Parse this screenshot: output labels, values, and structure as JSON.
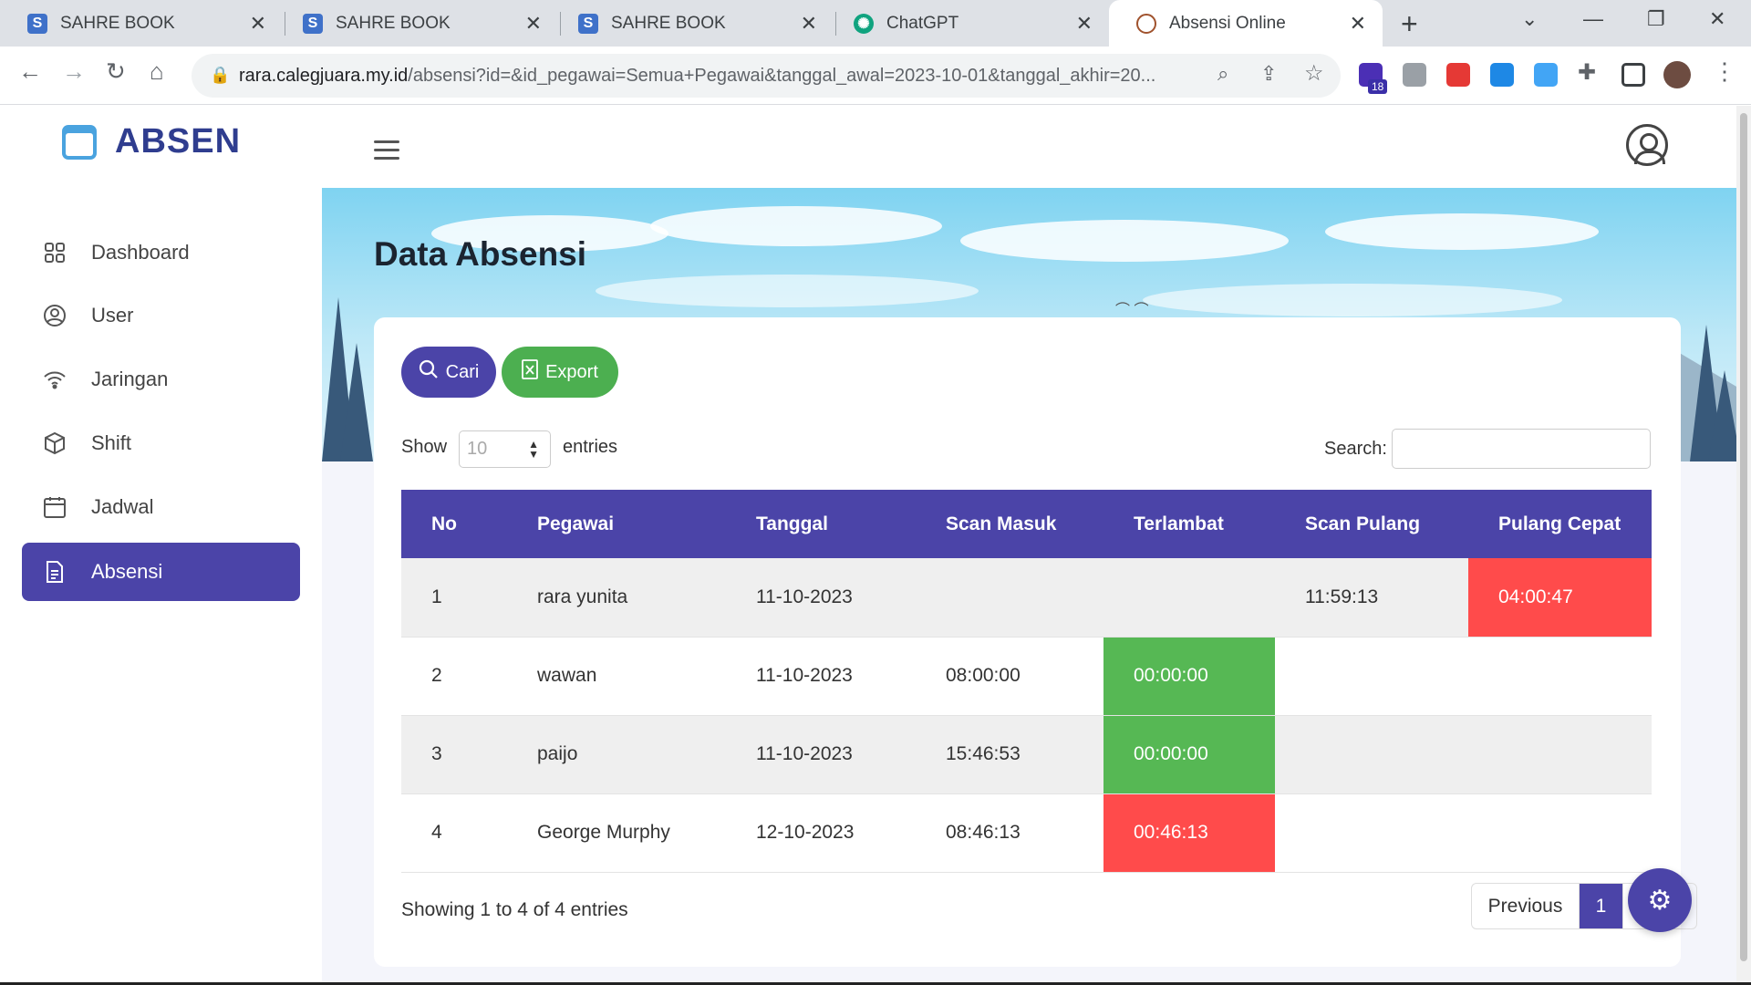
{
  "browser": {
    "tabs": [
      {
        "title": "SAHRE BOOK",
        "icon": "s-favicon",
        "color": "#3f71c9"
      },
      {
        "title": "SAHRE BOOK",
        "icon": "s-favicon",
        "color": "#3f71c9"
      },
      {
        "title": "SAHRE BOOK",
        "icon": "s-favicon",
        "color": "#3f71c9"
      },
      {
        "title": "ChatGPT",
        "icon": "chatgpt-favicon",
        "color": "#10a37f"
      },
      {
        "title": "Absensi Online",
        "icon": "absensi-favicon",
        "color": "#a0522d",
        "active": true
      }
    ],
    "url_host": "rara.calegjuara.my.id",
    "url_path": "/absensi?id=&id_pegawai=Semua+Pegawai&tanggal_awal=2023-10-01&tanggal_akhir=20...",
    "extension_badge": "18"
  },
  "app": {
    "logo_text": "ABSEN",
    "accent": "#4b44a8",
    "sidebar": [
      {
        "label": "Dashboard",
        "icon": "grid-icon"
      },
      {
        "label": "User",
        "icon": "user-circle-icon"
      },
      {
        "label": "Jaringan",
        "icon": "wifi-icon"
      },
      {
        "label": "Shift",
        "icon": "cube-icon"
      },
      {
        "label": "Jadwal",
        "icon": "calendar-icon"
      },
      {
        "label": "Absensi",
        "icon": "document-icon",
        "active": true
      }
    ],
    "page_title": "Data Absensi",
    "buttons": {
      "cari": "Cari",
      "export": "Export"
    },
    "length": {
      "show": "Show",
      "value": "10",
      "entries": "entries"
    },
    "search_label": "Search:",
    "table": {
      "headers": [
        "No",
        "Pegawai",
        "Tanggal",
        "Scan Masuk",
        "Terlambat",
        "Scan Pulang",
        "Pulang Cepat"
      ],
      "rows": [
        {
          "no": "1",
          "pegawai": "rara yunita",
          "tanggal": "11-10-2023",
          "scan_masuk": "",
          "terlambat": "",
          "scan_pulang": "11:59:13",
          "pulang_cepat": "04:00:47",
          "terlambat_status": "",
          "pulang_cepat_status": "red"
        },
        {
          "no": "2",
          "pegawai": "wawan",
          "tanggal": "11-10-2023",
          "scan_masuk": "08:00:00",
          "terlambat": "00:00:00",
          "scan_pulang": "",
          "pulang_cepat": "",
          "terlambat_status": "green",
          "pulang_cepat_status": ""
        },
        {
          "no": "3",
          "pegawai": "paijo",
          "tanggal": "11-10-2023",
          "scan_masuk": "15:46:53",
          "terlambat": "00:00:00",
          "scan_pulang": "",
          "pulang_cepat": "",
          "terlambat_status": "green",
          "pulang_cepat_status": ""
        },
        {
          "no": "4",
          "pegawai": "George Murphy",
          "tanggal": "12-10-2023",
          "scan_masuk": "08:46:13",
          "terlambat": "00:46:13",
          "scan_pulang": "",
          "pulang_cepat": "",
          "terlambat_status": "red",
          "pulang_cepat_status": ""
        }
      ]
    },
    "info": "Showing 1 to 4 of 4 entries",
    "pagination": {
      "previous": "Previous",
      "current": "1",
      "next": "Next"
    }
  }
}
